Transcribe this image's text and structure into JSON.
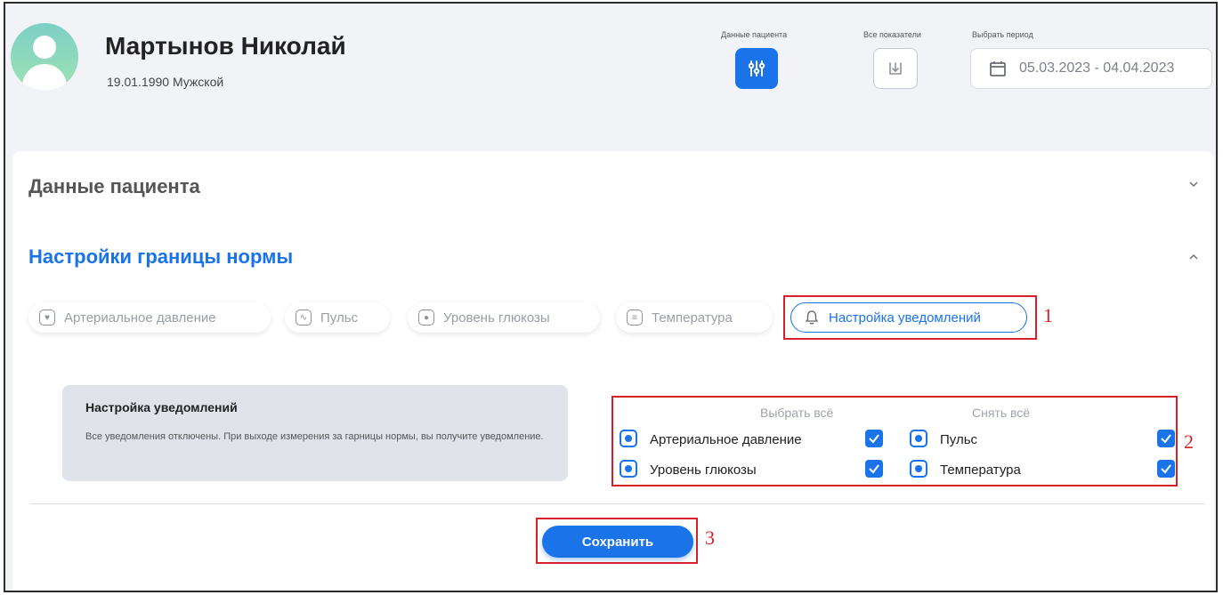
{
  "patient": {
    "name": "Мартынов Николай",
    "meta": "19.01.1990 Мужской"
  },
  "toolbar": {
    "patient_data_label": "Данные пациента",
    "all_indicators_label": "Все показатели",
    "period_label": "Выбрать период",
    "period_value": "05.03.2023 - 04.04.2023"
  },
  "sections": {
    "patient_data": "Данные пациента",
    "norm_settings": "Настройки границы нормы"
  },
  "tabs": [
    {
      "label": "Артериальное давление",
      "icon": "blood-pressure-icon"
    },
    {
      "label": "Пульс",
      "icon": "pulse-icon"
    },
    {
      "label": "Уровень глюкозы",
      "icon": "glucose-icon"
    },
    {
      "label": "Температура",
      "icon": "thermometer-icon"
    },
    {
      "label": "Настройка уведомлений",
      "icon": "bell-icon",
      "active": true
    }
  ],
  "notifications": {
    "title": "Настройка уведомлений",
    "description": "Все уведомления отключены. При выходе измерения за гарницы нормы, вы получите уведомление.",
    "select_all": "Выбрать всё",
    "clear_all": "Снять всё",
    "options": [
      {
        "label": "Артериальное давление",
        "checked": true
      },
      {
        "label": "Пульс",
        "checked": true
      },
      {
        "label": "Уровень глюкозы",
        "checked": true
      },
      {
        "label": "Температура",
        "checked": true
      }
    ]
  },
  "actions": {
    "save": "Сохранить"
  },
  "annotations": [
    "1",
    "2",
    "3"
  ],
  "colors": {
    "accent": "#1a73e8",
    "annotation": "#d6202a",
    "background": "#f2f3f7"
  }
}
